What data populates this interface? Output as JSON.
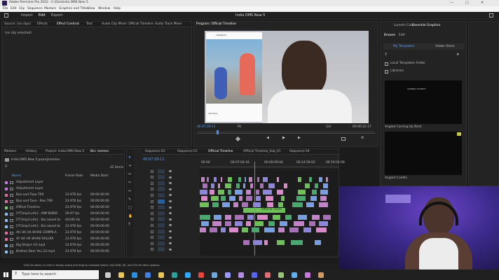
{
  "app": {
    "title": "Adobe Premiere Pro 2022 - C:\\Dro\\India DMS New 5",
    "window_controls": [
      "—",
      "□",
      "✕"
    ]
  },
  "menu": [
    "File",
    "Edit",
    "Clip",
    "Sequence",
    "Markers",
    "Graphics and Titles",
    "View",
    "Window",
    "Help"
  ],
  "workspace": {
    "tabs": [
      "Import",
      "Edit",
      "Export"
    ],
    "project_name": "India DMS New 5"
  },
  "source_panel": {
    "tabs": [
      "Source: (no clips)",
      "Effects",
      "Effect Controls",
      "Text",
      "Audio Clip Mixer: Official Timeline",
      "Audio Track Mixer"
    ],
    "message": "(no clip selected)"
  },
  "program": {
    "tab": "Program: Official Timeline",
    "timecode": "00:07:29:11",
    "fit": "Fit",
    "fraction": "1/4",
    "duration": "00:00:22:17",
    "post_user": "instagram",
    "post_likes": "129 likes"
  },
  "project_panel": {
    "tabs": [
      "Markers",
      "History",
      "Project: India DMS New 5",
      "Bin: memes"
    ],
    "path": "India DMS New 5.prproj\\memes",
    "count": "42 items",
    "columns": [
      "Name",
      "Frame Rate",
      "Media Start"
    ],
    "items": [
      {
        "name": "Adjustment Layer",
        "rate": "",
        "start": "",
        "color": "#c678dd"
      },
      {
        "name": "Adjustment Layer",
        "rate": "",
        "start": "",
        "color": "#c678dd"
      },
      {
        "name": "Boo and Tooo 709",
        "rate": "23.976 fps",
        "start": "00:00:00:00",
        "color": "#e06c9f"
      },
      {
        "name": "Boo and Tooo - Boo 709",
        "rate": "23.976 fps",
        "start": "00:00:00:00",
        "color": "#e06c9f"
      },
      {
        "name": "Offical Timeline",
        "rate": "23.976 fps",
        "start": "00:00:00:00",
        "color": "#7ec87e"
      },
      {
        "name": "[YT2mp3.info] - ANP BOND",
        "rate": "29.97 fps",
        "start": "00:00:00:00",
        "color": "#8fbcf0"
      },
      {
        "name": "[YT2mp3.info] - Kai raised ta",
        "rate": "44100 Hz",
        "start": "00:00:00:00",
        "color": "#8fbcf0"
      },
      {
        "name": "[YT2mp3.info] - Kai raised ta",
        "rate": "23.976 fps",
        "start": "00:00:00:00",
        "color": "#8fbcf0"
      },
      {
        "name": "AH HA HA WHAE COMPILA",
        "rate": "23.976 fps",
        "start": "00:00:00:00",
        "color": "#e06c9f"
      },
      {
        "name": "AY HA HA WHAE KALLRA",
        "rate": "23.976 fps",
        "start": "00:00:00:00",
        "color": "#e06c9f"
      },
      {
        "name": "Big Shaq's V2.mp4",
        "rate": "23.976 fps",
        "start": "00:00:00:00",
        "color": "#8fbcf0"
      },
      {
        "name": "Brother Bare You 22.mp4",
        "rate": "23.976 fps",
        "start": "00:00:00:00",
        "color": "#8fbcf0"
      }
    ]
  },
  "timeline": {
    "tabs": [
      "Sequence 02",
      "Sequence 01",
      "Official Timeline",
      "Official Timeline_Sub_01",
      "Sequence 04"
    ],
    "timecode": "00:07:29:11",
    "ruler": [
      "00:00",
      "00:07:04:16",
      "00:09:09:04",
      "00:14:59:02",
      "00:19:54:08"
    ],
    "clip_label": "Official Timel"
  },
  "right_panel": {
    "tabs": [
      "Lumetri Color",
      "Essential Graphics"
    ],
    "subtabs": [
      "Browse",
      "Edit"
    ],
    "template_tabs": [
      "My Templates",
      "Adobe Stock"
    ],
    "checks": [
      "Local Templates Folder",
      "Libraries"
    ],
    "templates": [
      {
        "name": "Angled Coming Up Next",
        "preview": "COMING UP NEXT"
      },
      {
        "name": "Angled Credits",
        "preview": ""
      }
    ]
  },
  "status_bar": "Click to select, or click in empty space and drag to marquee select. Use Shift, Alt, and Ctrl for other options.",
  "taskbar": {
    "search_placeholder": "Type here to search"
  }
}
